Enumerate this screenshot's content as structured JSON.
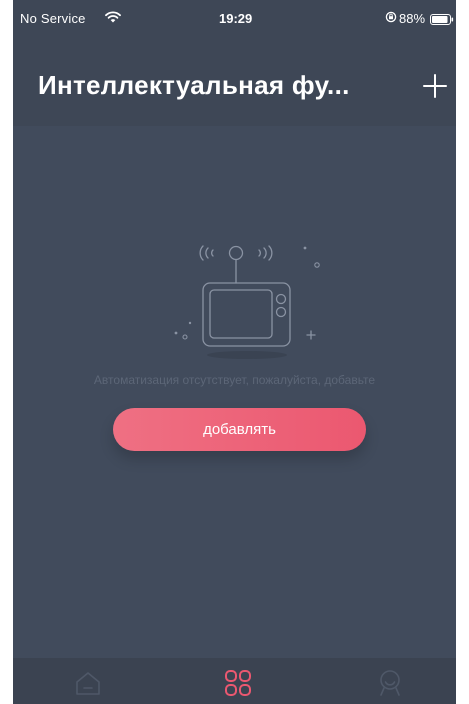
{
  "status_bar": {
    "carrier": "No Service",
    "time": "19:29",
    "battery_percent": "88%",
    "icons": [
      "wifi-icon",
      "orientation-lock-icon",
      "battery-icon"
    ]
  },
  "header": {
    "title": "Интеллектуальная фу...",
    "add_button_icon": "plus-icon"
  },
  "empty_state": {
    "illustration": "tv-with-antenna-icon",
    "message": "Автоматизация отсутствует, пожалуйста, добавьте",
    "button_label": "добавлять"
  },
  "tab_bar": {
    "tabs": [
      {
        "icon": "home-icon",
        "active": false
      },
      {
        "icon": "grid-icon",
        "active": true
      },
      {
        "icon": "profile-icon",
        "active": false
      }
    ]
  },
  "colors": {
    "background": "#414b5c",
    "header": "#3e4756",
    "accent": "#eb5870",
    "tab_inactive": "#4f5868"
  }
}
